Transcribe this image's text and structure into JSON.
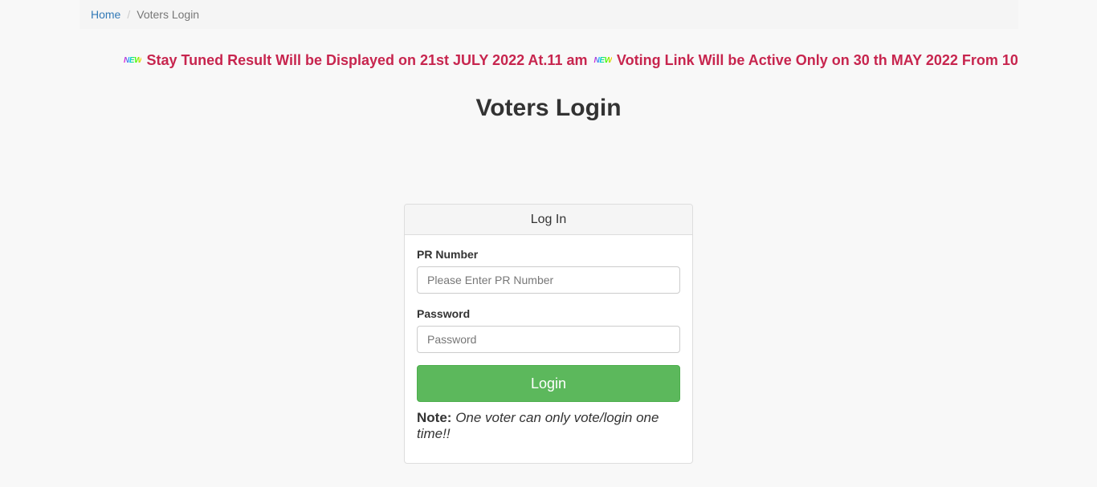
{
  "breadcrumb": {
    "home": "Home",
    "separator": "/",
    "current": "Voters Login"
  },
  "ticker": {
    "badge": "NEW",
    "items": [
      "Stay Tuned Result Will be Displayed on 21st JULY 2022 At.11 am",
      "Voting Link Will be Active Only on 30 th MAY 2022 From 10"
    ],
    "color": "#c7254e"
  },
  "page": {
    "title": "Voters Login"
  },
  "login_panel": {
    "heading": "Log In",
    "pr_label": "PR Number",
    "pr_placeholder": "Please Enter PR Number",
    "password_label": "Password",
    "password_placeholder": "Password",
    "login_button": "Login",
    "note_label": "Note:",
    "note_text": "One voter can only vote/login one time!!"
  },
  "colors": {
    "button": "#5cb85c",
    "link": "#337ab7"
  }
}
